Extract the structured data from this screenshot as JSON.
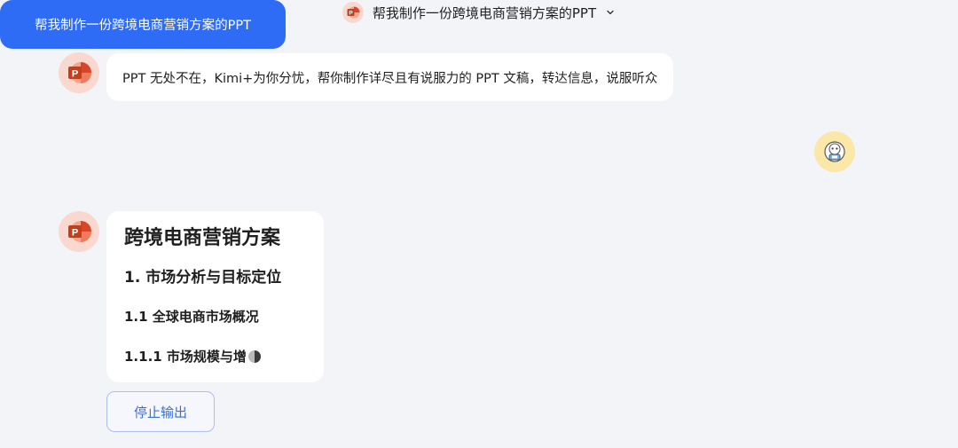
{
  "header": {
    "title": "帮我制作一份跨境电商营销方案的PPT",
    "app_icon": "ppt-icon",
    "dropdown_icon": "chevron-down-icon"
  },
  "messages": {
    "intro": {
      "text": "PPT 无处不在，Kimi+为你分忧，帮你制作详尽且有说服力的 PPT 文稿，转达信息，说服听众"
    },
    "user": {
      "text": "帮我制作一份跨境电商营销方案的PPT"
    },
    "outline": {
      "title": "跨境电商营销方案",
      "section": "1. 市场分析与目标定位",
      "subsection": "1.1 全球电商市场概况",
      "subsubsection": "1.1.1 市场规模与增"
    }
  },
  "actions": {
    "stop_label": "停止输出"
  },
  "colors": {
    "background": "#f3f4f8",
    "user_bubble": "#2f6cf6",
    "stop_text": "#3b6fd8",
    "ppt_orange": "#e8573c"
  }
}
